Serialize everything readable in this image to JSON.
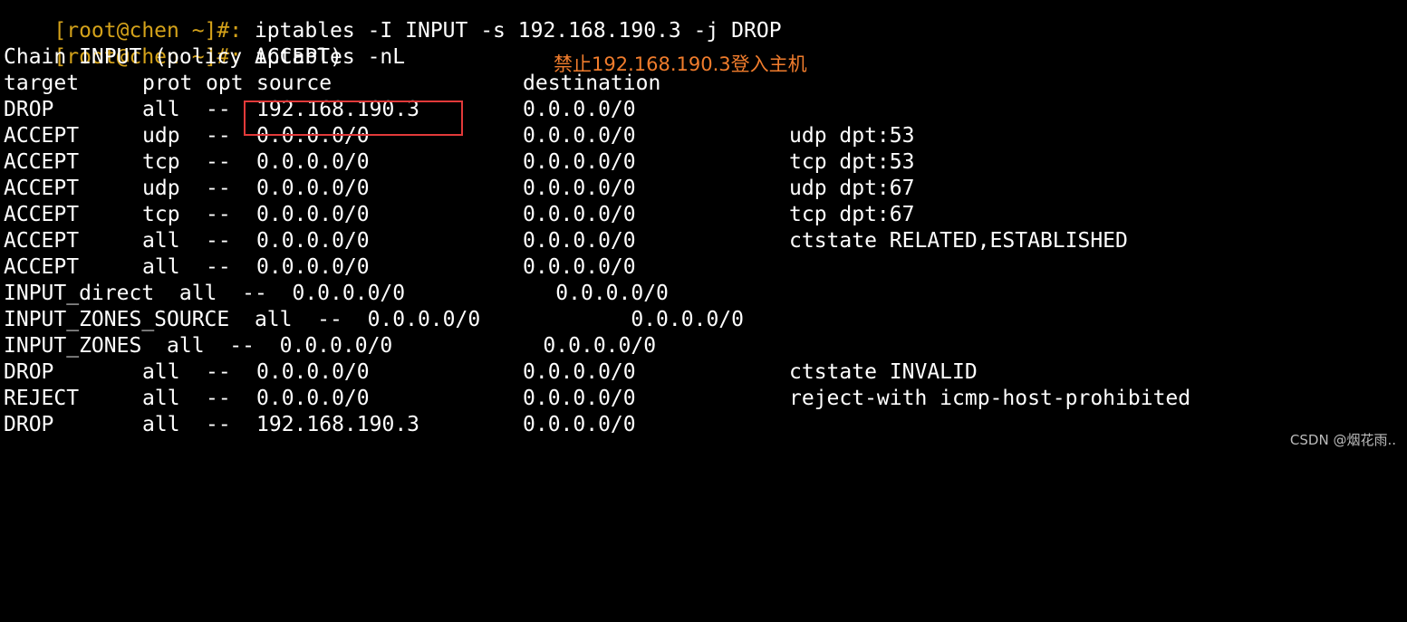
{
  "terminal": {
    "prompt_lines": [
      {
        "prompt": "[root@chen ~]#:",
        "command": " iptables -I INPUT -s 192.168.190.3 -j DROP"
      },
      {
        "prompt": "[root@chen ~]#:",
        "command": " iptables -nL"
      }
    ],
    "chain_header": "Chain INPUT (policy ACCEPT)",
    "column_headers": {
      "target": "target",
      "prot": "prot",
      "opt": "opt",
      "source": "source",
      "destination": "destination"
    },
    "rules": [
      {
        "target": "DROP",
        "prot": "all",
        "opt": "--",
        "source": "192.168.190.3",
        "destination": "0.0.0.0/0",
        "extra": ""
      },
      {
        "target": "ACCEPT",
        "prot": "udp",
        "opt": "--",
        "source": "0.0.0.0/0",
        "destination": "0.0.0.0/0",
        "extra": "udp dpt:53"
      },
      {
        "target": "ACCEPT",
        "prot": "tcp",
        "opt": "--",
        "source": "0.0.0.0/0",
        "destination": "0.0.0.0/0",
        "extra": "tcp dpt:53"
      },
      {
        "target": "ACCEPT",
        "prot": "udp",
        "opt": "--",
        "source": "0.0.0.0/0",
        "destination": "0.0.0.0/0",
        "extra": "udp dpt:67"
      },
      {
        "target": "ACCEPT",
        "prot": "tcp",
        "opt": "--",
        "source": "0.0.0.0/0",
        "destination": "0.0.0.0/0",
        "extra": "tcp dpt:67"
      },
      {
        "target": "ACCEPT",
        "prot": "all",
        "opt": "--",
        "source": "0.0.0.0/0",
        "destination": "0.0.0.0/0",
        "extra": "ctstate RELATED,ESTABLISHED"
      },
      {
        "target": "ACCEPT",
        "prot": "all",
        "opt": "--",
        "source": "0.0.0.0/0",
        "destination": "0.0.0.0/0",
        "extra": ""
      },
      {
        "raw": "INPUT_direct  all  --  0.0.0.0/0            0.0.0.0/0"
      },
      {
        "raw": "INPUT_ZONES_SOURCE  all  --  0.0.0.0/0            0.0.0.0/0"
      },
      {
        "raw": "INPUT_ZONES  all  --  0.0.0.0/0            0.0.0.0/0"
      },
      {
        "target": "DROP",
        "prot": "all",
        "opt": "--",
        "source": "0.0.0.0/0",
        "destination": "0.0.0.0/0",
        "extra": "ctstate INVALID"
      },
      {
        "target": "REJECT",
        "prot": "all",
        "opt": "--",
        "source": "0.0.0.0/0",
        "destination": "0.0.0.0/0",
        "extra": "reject-with icmp-host-prohibited"
      },
      {
        "target": "DROP",
        "prot": "all",
        "opt": "--",
        "source": "192.168.190.3",
        "destination": "0.0.0.0/0",
        "extra": ""
      }
    ]
  },
  "annotation": "禁止192.168.190.3登入主机",
  "watermark": "CSDN @烟花雨..",
  "colors": {
    "background": "#000000",
    "prompt": "#d4a21a",
    "text": "#ffffff",
    "annotation": "#f07c2c",
    "highlight_border": "#e23a3a"
  }
}
